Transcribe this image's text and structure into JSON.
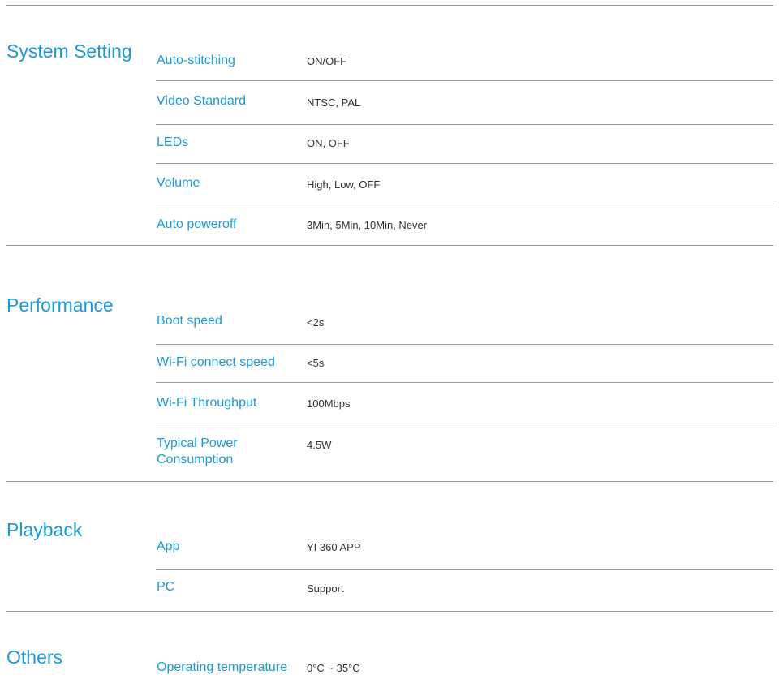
{
  "sections": [
    {
      "title": "System Setting",
      "rows": [
        {
          "label": "Auto-stitching",
          "value": "ON/OFF"
        },
        {
          "label": "Video Standard",
          "value": "NTSC, PAL"
        },
        {
          "label": "LEDs",
          "value": "ON, OFF"
        },
        {
          "label": "Volume",
          "value": "High, Low, OFF"
        },
        {
          "label": "Auto poweroff",
          "value": "3Min, 5Min, 10Min, Never"
        }
      ]
    },
    {
      "title": "Performance",
      "rows": [
        {
          "label": "Boot speed",
          "value": "<2s"
        },
        {
          "label": "Wi-Fi connect speed",
          "value": "<5s"
        },
        {
          "label": "Wi-Fi Throughput",
          "value": "100Mbps"
        },
        {
          "label": "Typical Power Consumption",
          "value": "4.5W"
        }
      ]
    },
    {
      "title": "Playback",
      "rows": [
        {
          "label": "App",
          "value": "YI 360 APP"
        },
        {
          "label": "PC",
          "value": "Support"
        }
      ]
    },
    {
      "title": "Others",
      "rows": [
        {
          "label": "Operating temperature",
          "value": "0°C ~ 35°C"
        }
      ]
    }
  ]
}
